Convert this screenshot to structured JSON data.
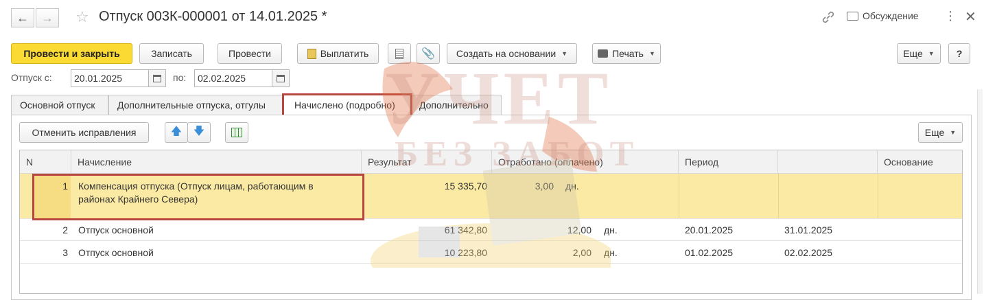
{
  "window": {
    "title": "Отпуск 003К-000001 от 14.01.2025 *",
    "discussion_label": "Обсуждение",
    "icons": [
      "back-arrow-icon",
      "forward-arrow-icon",
      "star-icon",
      "link-icon",
      "discussion-icon",
      "more-vertical-icon",
      "close-icon"
    ]
  },
  "toolbar": {
    "post_close": "Провести и закрыть",
    "save": "Записать",
    "post": "Провести",
    "pay": "Выплатить",
    "create_based": "Создать на основании",
    "print": "Печать",
    "more": "Еще",
    "help": "?"
  },
  "period": {
    "from_label": "Отпуск с:",
    "from_value": "20.01.2025",
    "to_label": "по:",
    "to_value": "02.02.2025"
  },
  "tabs": [
    {
      "label": "Основной отпуск",
      "active": false
    },
    {
      "label": "Дополнительные отпуска, отгулы",
      "active": false
    },
    {
      "label": "Начислено (подробно)",
      "active": true
    },
    {
      "label": "Дополнительно",
      "active": false
    }
  ],
  "panel_toolbar": {
    "cancel_corrections": "Отменить исправления",
    "more": "Еще"
  },
  "table": {
    "columns": [
      "N",
      "Начисление",
      "Результат",
      "Отработано (оплачено)",
      "Период",
      "",
      "Основание"
    ],
    "rows": [
      {
        "n": "1",
        "accrual_line1": "Компенсация отпуска (Отпуск лицам, работающим в",
        "accrual_line2": "районах Крайнего Севера)",
        "result": "15 335,70",
        "worked": "3,00",
        "unit": "дн.",
        "period_from": "",
        "period_to": "",
        "basis": ""
      },
      {
        "n": "2",
        "accrual_line1": "Отпуск основной",
        "accrual_line2": "",
        "result": "61 342,80",
        "worked": "12,00",
        "unit": "дн.",
        "period_from": "20.01.2025",
        "period_to": "31.01.2025",
        "basis": ""
      },
      {
        "n": "3",
        "accrual_line1": "Отпуск основной",
        "accrual_line2": "",
        "result": "10 223,80",
        "worked": "2,00",
        "unit": "дн.",
        "period_from": "01.02.2025",
        "period_to": "02.02.2025",
        "basis": ""
      }
    ]
  },
  "watermark": {
    "line1": "УЧЕТ",
    "line2": "БЕЗ ЗАБОТ"
  },
  "colors": {
    "primary_button": "#fbdb33",
    "selected_row": "#fbeaa4",
    "highlight_frame": "#b8453f",
    "arrow_blue": "#3b8ed8"
  }
}
